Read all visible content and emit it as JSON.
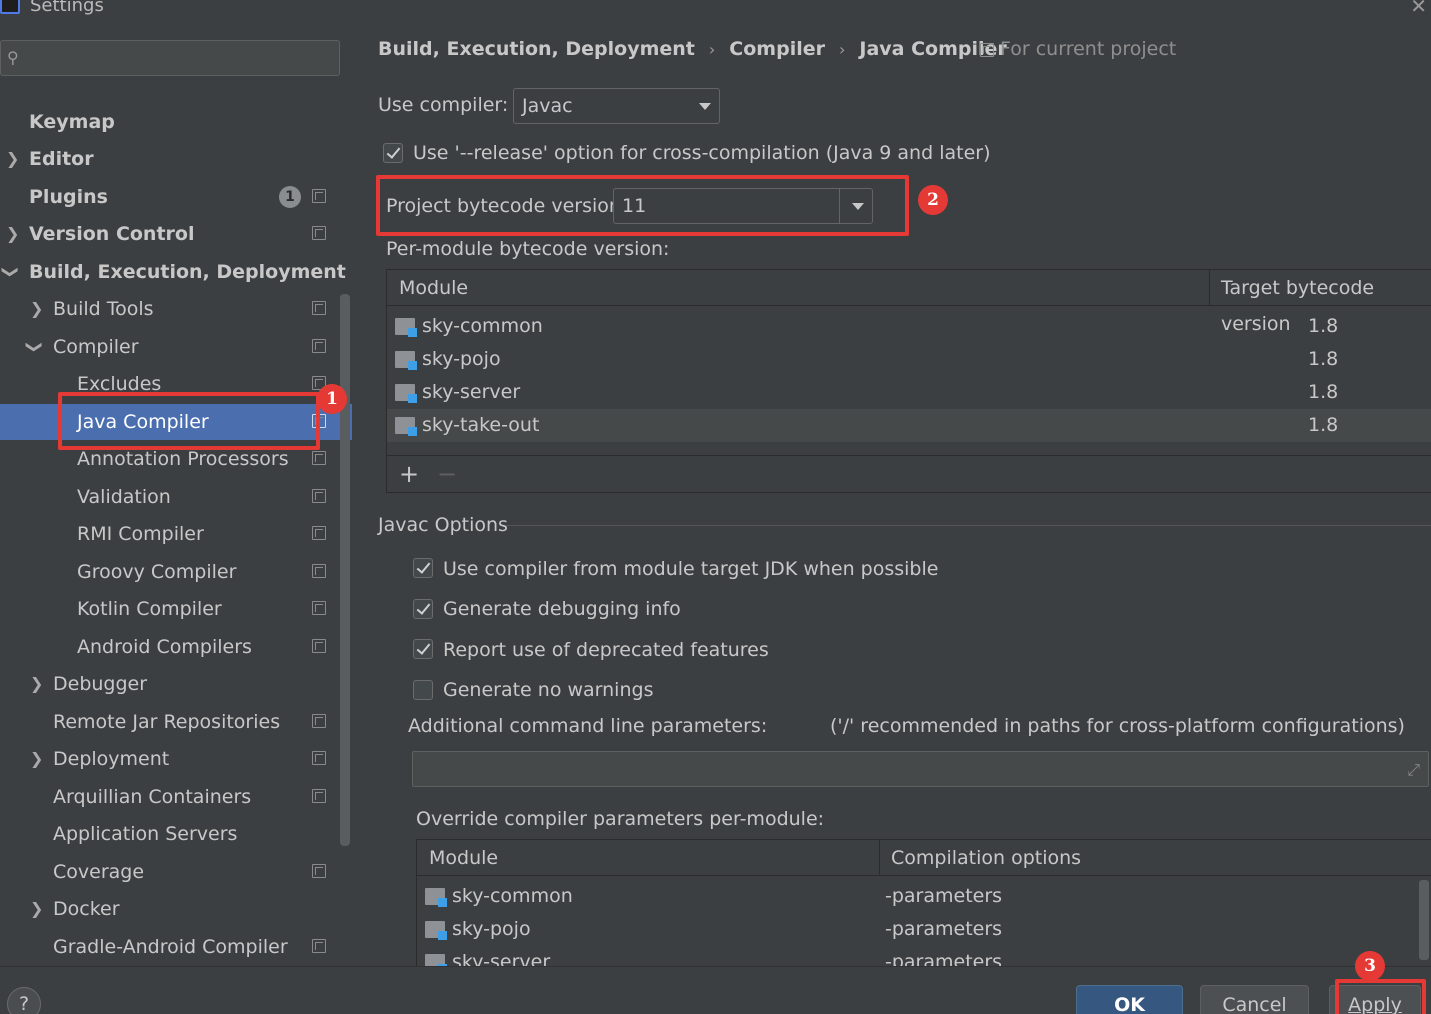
{
  "window": {
    "title": "Settings",
    "close_icon": "close-icon"
  },
  "sidebar": {
    "search_placeholder": "",
    "items": [
      {
        "label": "Keymap"
      },
      {
        "label": "Editor"
      },
      {
        "label": "Plugins",
        "badge": "1"
      },
      {
        "label": "Version Control"
      },
      {
        "label": "Build, Execution, Deployment"
      },
      {
        "label": "Build Tools"
      },
      {
        "label": "Compiler"
      },
      {
        "label": "Excludes"
      },
      {
        "label": "Java Compiler"
      },
      {
        "label": "Annotation Processors"
      },
      {
        "label": "Validation"
      },
      {
        "label": "RMI Compiler"
      },
      {
        "label": "Groovy Compiler"
      },
      {
        "label": "Kotlin Compiler"
      },
      {
        "label": "Android Compilers"
      },
      {
        "label": "Debugger"
      },
      {
        "label": "Remote Jar Repositories"
      },
      {
        "label": "Deployment"
      },
      {
        "label": "Arquillian Containers"
      },
      {
        "label": "Application Servers"
      },
      {
        "label": "Coverage"
      },
      {
        "label": "Docker"
      },
      {
        "label": "Gradle-Android Compiler"
      }
    ]
  },
  "breadcrumb": {
    "part1": "Build, Execution, Deployment",
    "part2": "Compiler",
    "part3": "Java Compiler",
    "separator": "›",
    "for_project": "For current project"
  },
  "compiler": {
    "use_compiler_label": "Use compiler:",
    "use_compiler_value": "Javac",
    "release_option_label": "Use '--release' option for cross-compilation (Java 9 and later)",
    "release_option_checked": true,
    "bytecode_label": "Project bytecode version:",
    "bytecode_value": "11",
    "per_module_label": "Per-module bytecode version:"
  },
  "module_table": {
    "col_module": "Module",
    "col_target": "Target bytecode version",
    "rows": [
      {
        "module": "sky-common",
        "version": "1.8"
      },
      {
        "module": "sky-pojo",
        "version": "1.8"
      },
      {
        "module": "sky-server",
        "version": "1.8"
      },
      {
        "module": "sky-take-out",
        "version": "1.8"
      }
    ],
    "add": "+",
    "remove": "−"
  },
  "javac_options": {
    "title": "Javac Options",
    "opt1": "Use compiler from module target JDK when possible",
    "opt2": "Generate debugging info",
    "opt3": "Report use of deprecated features",
    "opt4": "Generate no warnings",
    "additional_label": "Additional command line parameters:",
    "additional_hint": "('/' recommended in paths for cross-platform configurations)",
    "override_label": "Override compiler parameters per-module:"
  },
  "override_table": {
    "col_module": "Module",
    "col_options": "Compilation options",
    "rows": [
      {
        "module": "sky-common",
        "options": "-parameters"
      },
      {
        "module": "sky-pojo",
        "options": "-parameters"
      },
      {
        "module": "sky-server",
        "options": "-parameters"
      }
    ]
  },
  "footer": {
    "help": "?",
    "ok": "OK",
    "cancel": "Cancel",
    "apply": "Apply"
  },
  "markers": {
    "m1": "1",
    "m2": "2",
    "m3": "3"
  },
  "colors": {
    "highlight": "#e53935",
    "selection": "#4b6eaf",
    "primary_button": "#365880"
  }
}
